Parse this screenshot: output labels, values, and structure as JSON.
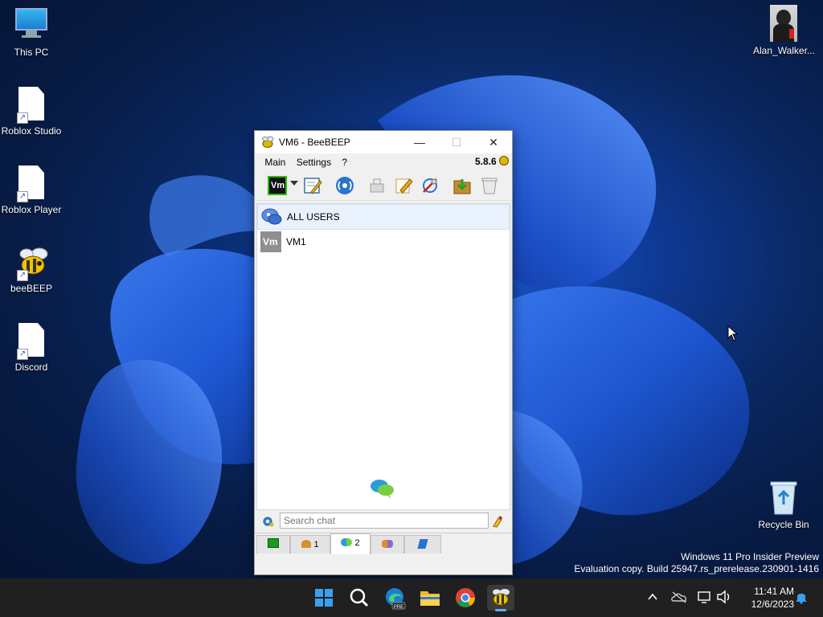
{
  "desktop": {
    "icons": [
      {
        "label": "This PC"
      },
      {
        "label": "Roblox Studio"
      },
      {
        "label": "Roblox Player"
      },
      {
        "label": "beeBEEP"
      },
      {
        "label": "Discord"
      },
      {
        "label": "Alan_Walker..."
      },
      {
        "label": "Recycle Bin"
      }
    ],
    "watermark": {
      "line1": "Windows 11 Pro Insider Preview",
      "line2": "Evaluation copy. Build 25947.rs_prerelease.230901-1416"
    }
  },
  "window": {
    "title": "VM6 - BeeBEEP",
    "controls": {
      "minimize": "—",
      "maximize": "☐",
      "close": "✕"
    },
    "menu": [
      "Main",
      "Settings",
      "?"
    ],
    "version": "5.8.6",
    "status_button_label": "Vm",
    "users": [
      {
        "name": "ALL USERS",
        "icon": "group-chat-icon",
        "selected": true
      },
      {
        "name": "VM1",
        "icon": "vm-avatar-icon",
        "avatar_text": "Vm",
        "selected": false
      }
    ],
    "search": {
      "placeholder": "Search chat",
      "value": ""
    },
    "tabs": [
      {
        "icon": "status-icon",
        "count": ""
      },
      {
        "icon": "users-icon",
        "count": "1"
      },
      {
        "icon": "chats-icon",
        "count": "2",
        "active": true
      },
      {
        "icon": "groups-icon",
        "count": ""
      },
      {
        "icon": "shares-icon",
        "count": ""
      }
    ]
  },
  "taskbar": {
    "apps": [
      "start-icon",
      "search-icon",
      "edge-icon",
      "file-explorer-icon",
      "chrome-icon",
      "beebeep-icon"
    ],
    "time": "11:41 AM",
    "date": "12/6/2023"
  },
  "colors": {
    "accent": "#1a56c8",
    "taskbar": "#202020",
    "status_green": "#22c000"
  }
}
